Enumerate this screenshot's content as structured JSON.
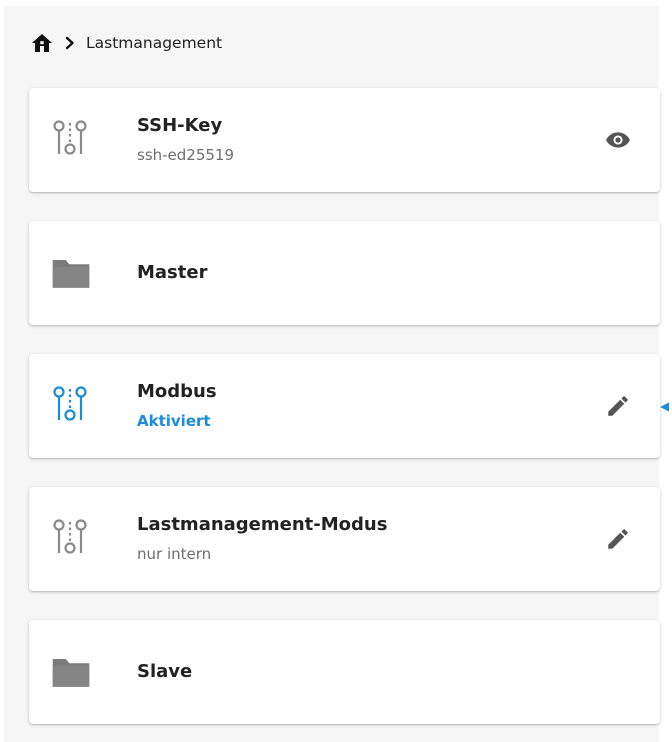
{
  "breadcrumb": {
    "home_icon": "home-icon",
    "separator_icon": "chevron-right-icon",
    "current": "Lastmanagement"
  },
  "cards": [
    {
      "icon": "setting-toggles-icon",
      "title": "SSH-Key",
      "subtitle": "ssh-ed25519",
      "action_icon": "eye-icon"
    },
    {
      "icon": "folder-icon",
      "title": "Master"
    },
    {
      "icon": "setting-toggles-icon",
      "title": "Modbus",
      "subtitle": "Aktiviert",
      "action_icon": "pencil-icon"
    },
    {
      "icon": "setting-toggles-icon",
      "title": "Lastmanagement-Modus",
      "subtitle": "nur intern",
      "action_icon": "pencil-icon"
    },
    {
      "icon": "folder-icon",
      "title": "Slave"
    }
  ],
  "colors": {
    "accent": "#1a8cd8",
    "icon_gray": "#8a8a8a",
    "folder_gray": "#7b7b7b",
    "panel_bg": "#f6f6f6"
  }
}
